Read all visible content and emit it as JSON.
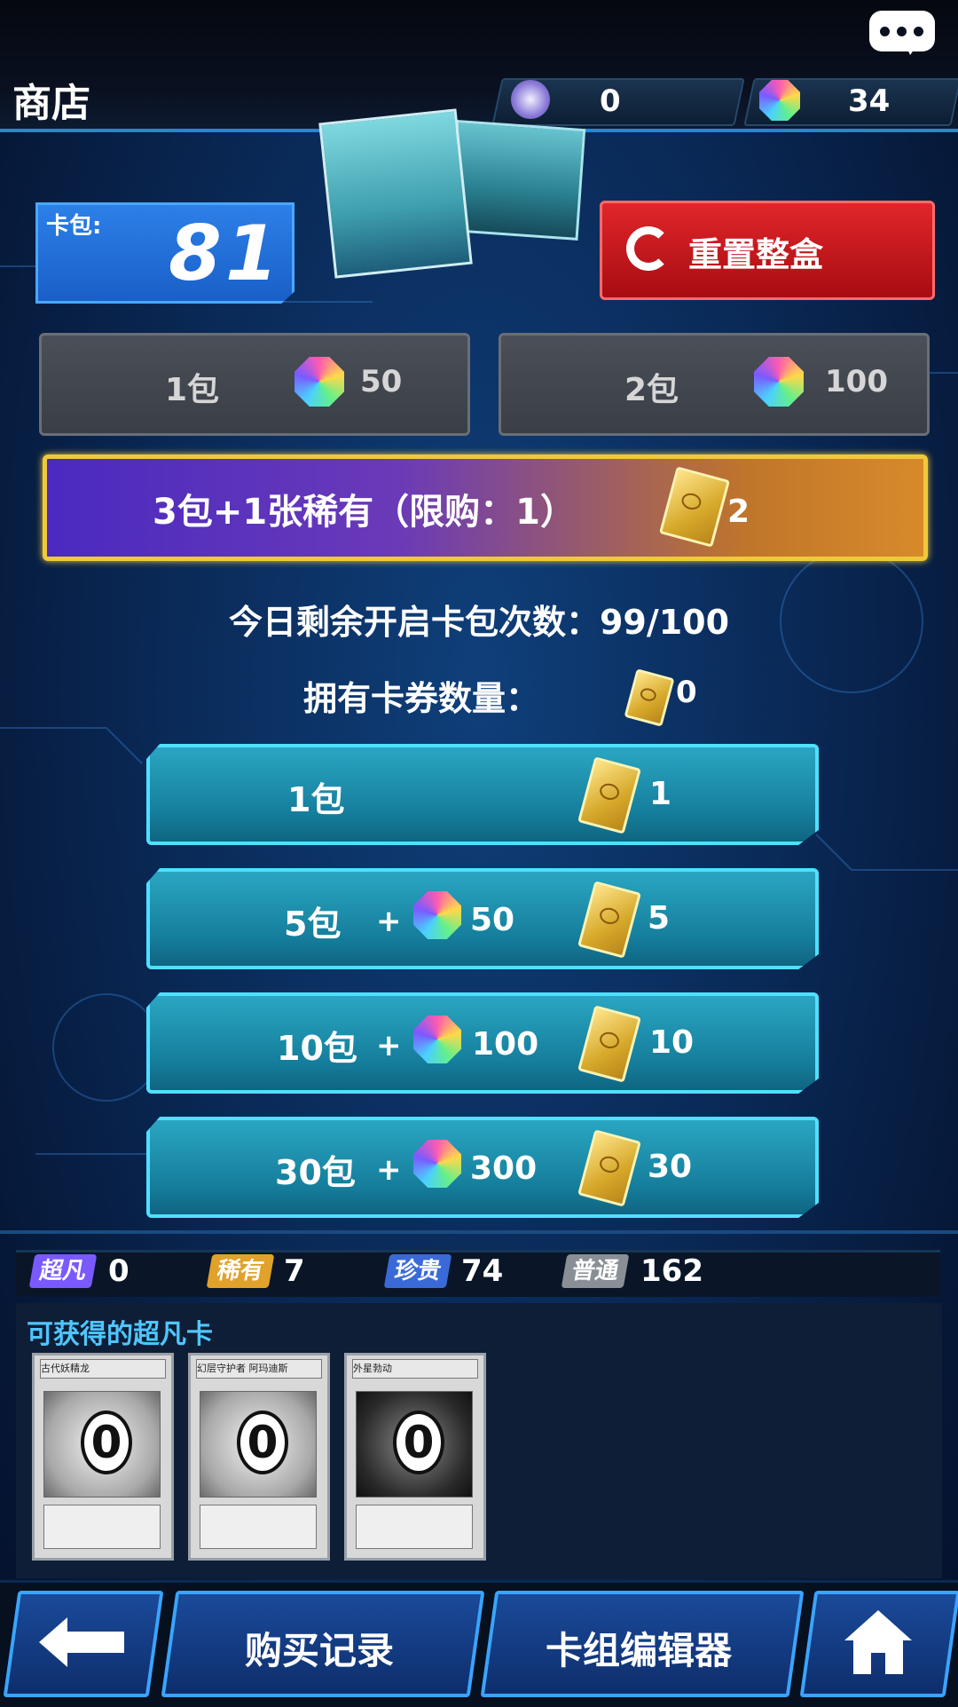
{
  "header": {
    "title": "商店",
    "currency_points": "0",
    "currency_gems": "34"
  },
  "pack": {
    "label": "卡包:",
    "count": "81",
    "reset_label": "重置整盒"
  },
  "buy_gems": [
    {
      "label": "1包",
      "price": "50"
    },
    {
      "label": "2包",
      "price": "100"
    }
  ],
  "special_offer": {
    "label": "3包+1张稀有（限购：1）",
    "ticket_cost": "2"
  },
  "info": {
    "daily_remaining": "今日剩余开启卡包次数：99/100",
    "owned_tickets_label": "拥有卡券数量：",
    "owned_tickets": "0"
  },
  "ticket_options": [
    {
      "label": "1包",
      "plus": "",
      "gems": "",
      "tickets": "1"
    },
    {
      "label": "5包",
      "plus": "+",
      "gems": "50",
      "tickets": "5"
    },
    {
      "label": "10包",
      "plus": "+",
      "gems": "100",
      "tickets": "10"
    },
    {
      "label": "30包",
      "plus": "+",
      "gems": "300",
      "tickets": "30"
    }
  ],
  "rarity": [
    {
      "badge": "超凡",
      "count": "0",
      "color": "#7a5aff"
    },
    {
      "badge": "稀有",
      "count": "7",
      "color": "#e0a22a"
    },
    {
      "badge": "珍贵",
      "count": "74",
      "color": "#3a6ad8"
    },
    {
      "badge": "普通",
      "count": "162",
      "color": "#8a8f96"
    }
  ],
  "obtainable": {
    "title": "可获得的超凡卡",
    "cards": [
      {
        "name": "古代妖精龙",
        "count": "0"
      },
      {
        "name": "幻层守护者 阿玛迪斯",
        "count": "0"
      },
      {
        "name": "外星勃动",
        "count": "0"
      }
    ]
  },
  "nav": {
    "back_icon": "arrow-left-icon",
    "history_label": "购买记录",
    "deck_label": "卡组编辑器",
    "home_icon": "home-icon"
  }
}
